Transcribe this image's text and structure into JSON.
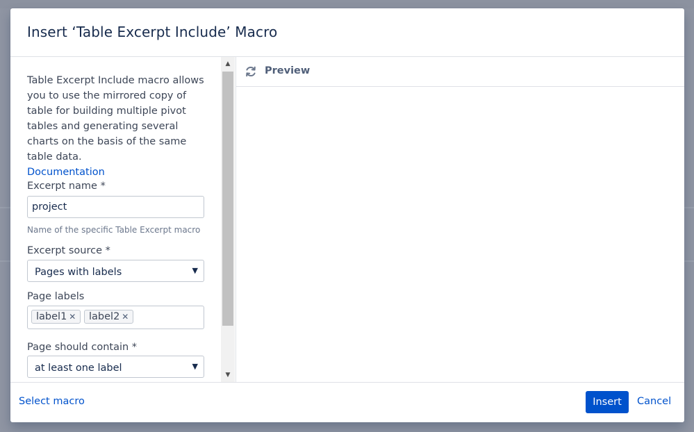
{
  "dialog": {
    "title": "Insert ‘Table Excerpt Include’ Macro"
  },
  "left": {
    "description": "Table Excerpt Include macro allows you to use the mirrored copy of table for building multiple pivot tables and generating several charts on the basis of the same table data.",
    "doc_link": "Documentation",
    "excerpt_name": {
      "label": "Excerpt name *",
      "value": "project",
      "help": "Name of the specific Table Excerpt macro"
    },
    "excerpt_source": {
      "label": "Excerpt source *",
      "selected": "Pages with labels"
    },
    "page_labels": {
      "label": "Page labels",
      "tags": [
        "label1",
        "label2"
      ]
    },
    "page_contain": {
      "label": "Page should contain *",
      "selected": "at least one label"
    }
  },
  "preview": {
    "label": "Preview"
  },
  "footer": {
    "select_macro": "Select macro",
    "insert": "Insert",
    "cancel": "Cancel"
  },
  "colors": {
    "primary": "#0052cc",
    "overlay": "#8f95a3",
    "text": "#172b4d"
  },
  "icons": {
    "refresh": "refresh-icon",
    "tag_remove": "close-icon",
    "dropdown": "chevron-down-icon"
  }
}
